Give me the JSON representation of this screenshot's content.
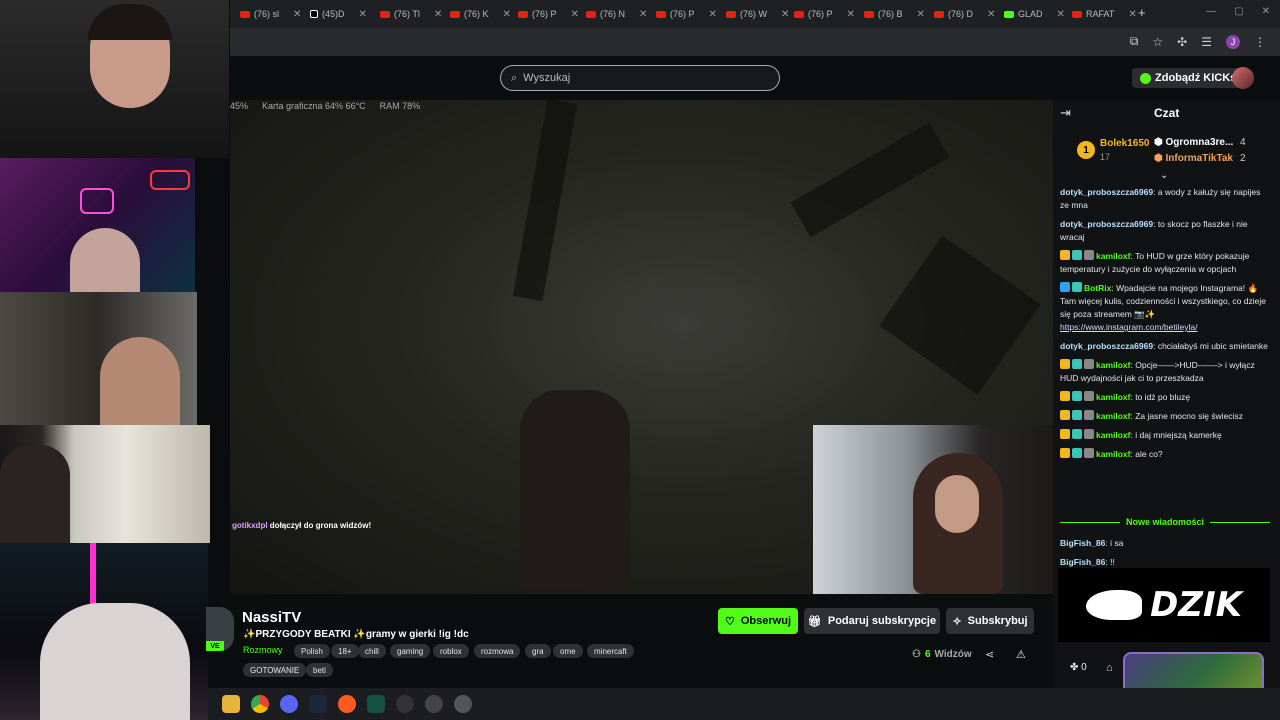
{
  "browser": {
    "tabs": [
      {
        "label": "(76) sl",
        "icon": "youtube-icon"
      },
      {
        "label": "(45)D",
        "icon": "tiktok-icon"
      },
      {
        "label": "(76) Tl",
        "icon": "youtube-icon"
      },
      {
        "label": "(76) K",
        "icon": "youtube-icon"
      },
      {
        "label": "(76) P",
        "icon": "youtube-icon"
      },
      {
        "label": "(76) N",
        "icon": "youtube-icon"
      },
      {
        "label": "(76) P",
        "icon": "youtube-icon"
      },
      {
        "label": "(76) W",
        "icon": "youtube-icon"
      },
      {
        "label": "(76) P",
        "icon": "youtube-icon"
      },
      {
        "label": "(76) B",
        "icon": "youtube-icon"
      },
      {
        "label": "(76) D",
        "icon": "youtube-icon"
      },
      {
        "label": "GLAD",
        "icon": "kick-icon"
      },
      {
        "label": "RAFAT",
        "icon": "youtube-icon"
      }
    ],
    "new_tab": "+",
    "profile_letter": "J"
  },
  "header": {
    "search_placeholder": "Wyszukaj",
    "kicks_button": "Zdobądź KICKs"
  },
  "overlay": {
    "stats": [
      "45%",
      "Karta graficzna  64%  66°C",
      "RAM  78%"
    ],
    "notification_user": "gotikxdpl",
    "notification_text": "dołączył do grona widzów!"
  },
  "channel": {
    "name": "NassiTV",
    "title": "✨PRZYGODY BEATKI ✨gramy w gierki !ig !dc",
    "category": "Rozmowy",
    "tags": [
      "Polish",
      "18+",
      "chill",
      "gaming",
      "roblox",
      "rozmowa",
      "gra",
      "ome",
      "minercaft",
      "GOTOWANIE",
      "beti"
    ],
    "follow_label": "Obserwuj",
    "gift_label": "Podaruj subskrypcje",
    "sub_label": "Subskrybuj",
    "viewers_count": "6",
    "viewers_label": "Widzów",
    "live_badge": "VE"
  },
  "chat": {
    "title": "Czat",
    "leaderboard": {
      "first": {
        "rank": "1",
        "name": "Bolek1650",
        "count": "17"
      },
      "second": {
        "name": "Ogromna3re...",
        "count": "4"
      },
      "third": {
        "name": "InformaTikTak",
        "count": "2"
      }
    },
    "messages": [
      {
        "user": "dotyk_proboszcza6969",
        "text": "a wody z kałuży się napijes ze mna",
        "style": "d",
        "badges": []
      },
      {
        "user": "dotyk_proboszcza6969",
        "text": "to skocz po flaszke i nie wracaj",
        "style": "d",
        "badges": []
      },
      {
        "user": "kamiloxf",
        "text": "To HUD w grze który pokazuje temperatury i zużycie do wyłączenia w opcjach",
        "style": "k",
        "badges": [
          "c",
          "s",
          "w"
        ]
      },
      {
        "user": "BotRix",
        "text": "Wpadajcie na mojego Instagrama! 🔥 Tam więcej kulis, codzienności i wszystkiego, co dzieje się poza streamem 📷✨ ",
        "link": "https://www.instagram.com/betileyla/",
        "style": "b",
        "badges": [
          "v",
          "s"
        ]
      },
      {
        "user": "dotyk_proboszcza6969",
        "text": "chciałabyś mi ubic smietanke",
        "style": "d",
        "badges": []
      },
      {
        "user": "kamiloxf",
        "text": "Opcje——>HUD-——> i wyłącz HUD wydajności jak ci to przeszkadza",
        "style": "k",
        "badges": [
          "c",
          "s",
          "w"
        ]
      },
      {
        "user": "kamiloxf",
        "text": "to idż po bluzę",
        "style": "k",
        "badges": [
          "c",
          "s",
          "w"
        ]
      },
      {
        "user": "kamiloxf",
        "text": "Za jasne mocno się świecisz",
        "style": "k",
        "badges": [
          "c",
          "s",
          "w"
        ]
      },
      {
        "user": "kamiloxf",
        "text": "i daj mniejszą kamerkę",
        "style": "k",
        "badges": [
          "c",
          "s",
          "w"
        ]
      },
      {
        "user": "kamiloxf",
        "text": "ale co?",
        "style": "k",
        "badges": [
          "c",
          "s",
          "w"
        ]
      }
    ],
    "new_messages_label": "Nowe wiadomości",
    "new_messages": [
      {
        "user": "BigFish_86",
        "text": "i sa",
        "style": "f",
        "badges": []
      },
      {
        "user": "BigFish_86",
        "text": "!!",
        "style": "f",
        "badges": []
      }
    ],
    "sponsor": "DZIK",
    "gifts_count": "0"
  },
  "colors": {
    "accent": "#53fc18",
    "bg": "#0b0e0f",
    "chat_bg": "#111213"
  }
}
